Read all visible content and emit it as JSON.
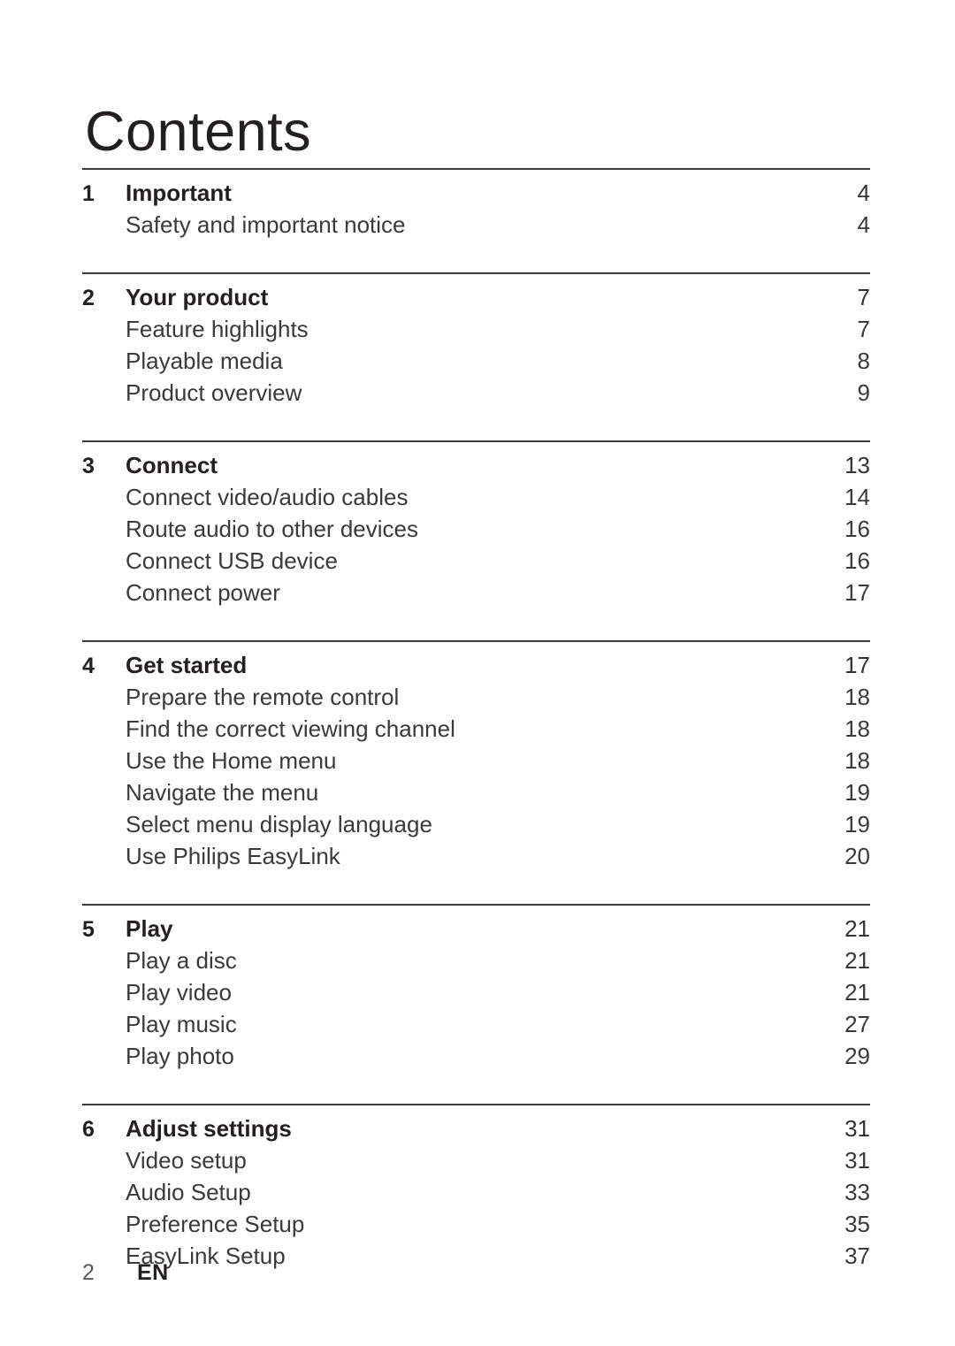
{
  "document": {
    "title": "Contents"
  },
  "toc": {
    "sections": [
      {
        "number": "1",
        "title": "Important",
        "page": "4",
        "items": [
          {
            "label": "Safety and important notice",
            "page": "4"
          }
        ]
      },
      {
        "number": "2",
        "title": "Your product",
        "page": "7",
        "items": [
          {
            "label": "Feature highlights",
            "page": "7"
          },
          {
            "label": "Playable media",
            "page": "8"
          },
          {
            "label": "Product overview",
            "page": "9"
          }
        ]
      },
      {
        "number": "3",
        "title": "Connect",
        "page": "13",
        "items": [
          {
            "label": "Connect video/audio cables",
            "page": "14"
          },
          {
            "label": "Route audio to other devices",
            "page": "16"
          },
          {
            "label": "Connect USB device",
            "page": "16"
          },
          {
            "label": "Connect power",
            "page": "17"
          }
        ]
      },
      {
        "number": "4",
        "title": "Get started",
        "page": "17",
        "items": [
          {
            "label": "Prepare the remote control",
            "page": "18"
          },
          {
            "label": "Find the correct viewing channel",
            "page": "18"
          },
          {
            "label": "Use the Home menu",
            "page": "18"
          },
          {
            "label": "Navigate the menu",
            "page": "19"
          },
          {
            "label": "Select menu display language",
            "page": "19"
          },
          {
            "label": "Use Philips EasyLink",
            "page": "20"
          }
        ]
      },
      {
        "number": "5",
        "title": "Play",
        "page": "21",
        "items": [
          {
            "label": "Play a disc",
            "page": "21"
          },
          {
            "label": "Play video",
            "page": "21"
          },
          {
            "label": "Play music",
            "page": "27"
          },
          {
            "label": "Play photo",
            "page": "29"
          }
        ]
      },
      {
        "number": "6",
        "title": "Adjust settings",
        "page": "31",
        "items": [
          {
            "label": "Video setup",
            "page": "31"
          },
          {
            "label": "Audio Setup",
            "page": "33"
          },
          {
            "label": "Preference Setup",
            "page": "35"
          },
          {
            "label": "EasyLink Setup",
            "page": "37"
          }
        ]
      }
    ]
  },
  "footer": {
    "page_number": "2",
    "language": "EN"
  },
  "colors": {
    "text": "#3a3a3a",
    "heading": "#231f20",
    "rule": "#3b3b3b",
    "background": "#ffffff"
  }
}
